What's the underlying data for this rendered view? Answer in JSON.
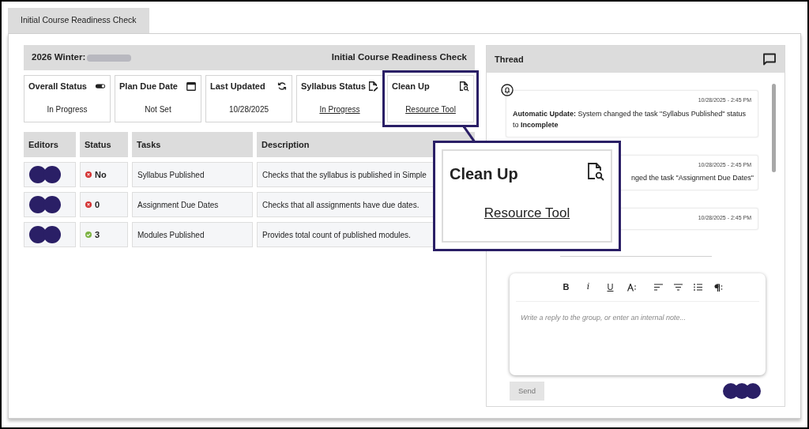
{
  "tab": {
    "label": "Initial Course Readiness Check",
    "selected": true
  },
  "header": {
    "term": "2026 Winter:",
    "title": "Initial Course Readiness Check"
  },
  "cards": [
    {
      "title": "Overall Status",
      "value": "In Progress",
      "link": false,
      "highlighted": false
    },
    {
      "title": "Plan Due Date",
      "value": "Not Set",
      "link": false,
      "highlighted": false
    },
    {
      "title": "Last Updated",
      "value": "10/28/2025",
      "link": false,
      "highlighted": false
    },
    {
      "title": "Syllabus Status",
      "value": "In Progress",
      "link": true,
      "highlighted": false
    },
    {
      "title": "Clean Up",
      "value": "Resource Tool",
      "link": true,
      "highlighted": true
    }
  ],
  "table": {
    "columns": [
      "Editors",
      "Status",
      "Tasks",
      "Description"
    ],
    "rows": [
      {
        "status": "No",
        "passed": false,
        "task": "Syllabus Published",
        "description": "Checks that the syllabus is published in Simple"
      },
      {
        "status": "0",
        "passed": false,
        "task": "Assignment Due Dates",
        "description": "Checks that all assignments have due dates."
      },
      {
        "status": "3",
        "passed": true,
        "task": "Modules Published",
        "description": "Provides total count of published modules."
      }
    ]
  },
  "callout": {
    "title": "Clean Up",
    "link": "Resource Tool"
  },
  "thread": {
    "title": "Thread",
    "messages": [
      {
        "time": "10/28/2025 - 2:45 PM",
        "text": "**Automatic Update:** System changed the task \"Syllabus Published\" status to **Incomplete**"
      },
      {
        "time": "10/28/2025 - 2:45 PM",
        "text": "nged the task \"Assignment Due Dates\""
      },
      {
        "time": "10/28/2025 - 2:45 PM"
      }
    ],
    "toolbar": [
      "B",
      "i",
      "U"
    ],
    "placeholder": "Write a reply to the group, or enter an internal note...",
    "send": {
      "label": "Send",
      "disabled": true
    }
  }
}
